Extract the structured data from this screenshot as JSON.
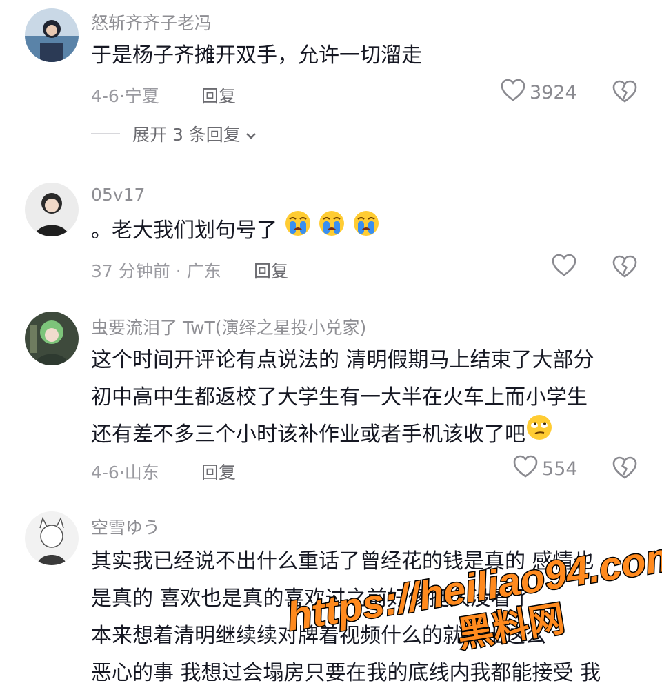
{
  "comments": [
    {
      "user": "怒斩齐齐子老冯",
      "text_lines": [
        "于是杨子齐摊开双手，允许一切溜走"
      ],
      "date": "4-6",
      "location": "宁夏",
      "reply_label": "回复",
      "likes": "3924",
      "expand_label": "展开 3 条回复"
    },
    {
      "user": "05v17",
      "text_lines": [
        "。老大我们划句号了"
      ],
      "emoji": [
        "crying-face",
        "crying-face",
        "crying-face"
      ],
      "date": "37 分钟前",
      "location": "广东",
      "reply_label": "回复",
      "likes": ""
    },
    {
      "user": "虫要流泪了 TwT(演绎之星投小兑家)",
      "text_lines": [
        "这个时间开评论有点说法的 清明假期马上结束了大部分",
        "初中高中生都返校了大学生有一大半在火车上而小学生",
        "还有差不多三个小时该补作业或者手机该收了吧"
      ],
      "emoji": [
        "eye-roll-face"
      ],
      "date": "4-6",
      "location": "山东",
      "reply_label": "回复",
      "likes": "554"
    },
    {
      "user": "空雪ゆう",
      "text_lines": [
        "其实我已经说不出什么重话了曾经花的钱是真的 感情也",
        "是真的 喜欢也是真的喜欢过之前好像挺久没看了",
        "本来想着清明继续续对牌着视频什么的就爆出这么",
        "恶心的事 我想过会塌房只要在我的底线内我都能接受 我"
      ]
    }
  ],
  "watermark": {
    "url": "https://heiliao94.com",
    "label": "黑料网"
  },
  "colors": {
    "text": "#161823",
    "meta": "#9a9aa0",
    "watermark_fill": "#ff8a1e"
  }
}
